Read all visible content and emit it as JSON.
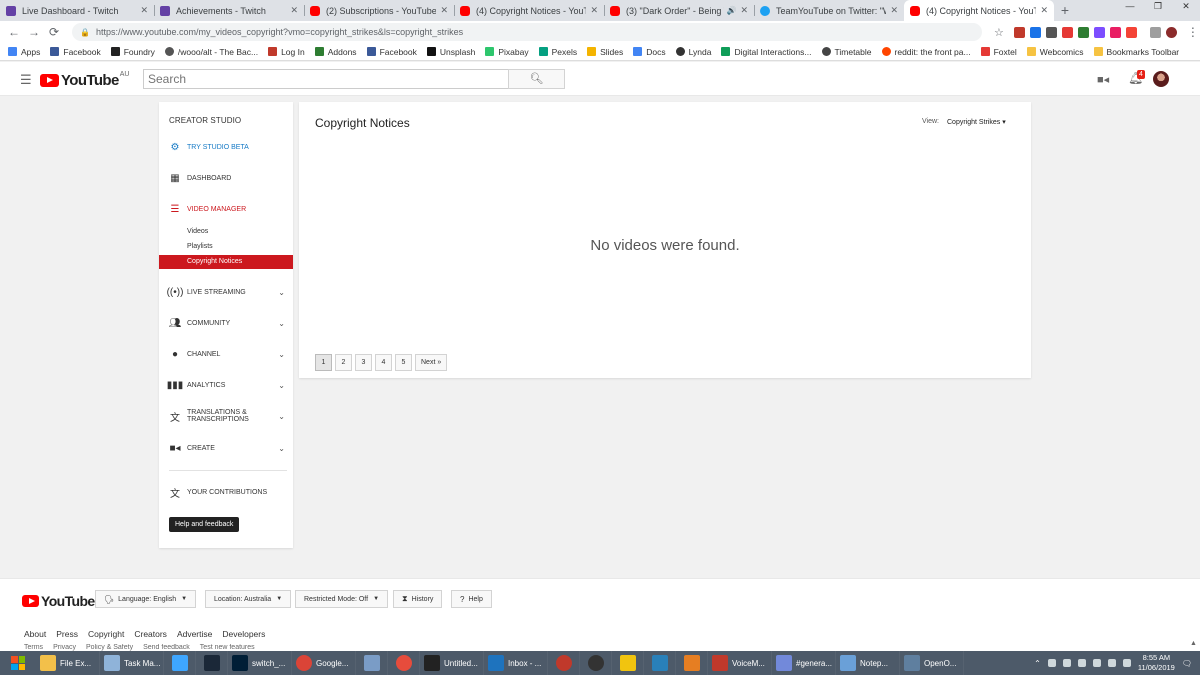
{
  "browser": {
    "tabs": [
      {
        "title": "Live Dashboard - Twitch",
        "icon": "twitch-icon",
        "active": false
      },
      {
        "title": "Achievements - Twitch",
        "icon": "twitch-icon",
        "active": false
      },
      {
        "title": "(2) Subscriptions - YouTube",
        "icon": "youtube-icon",
        "active": false
      },
      {
        "title": "(4) Copyright Notices - YouTube",
        "icon": "youtube-icon",
        "active": false
      },
      {
        "title": "(3) \"Dark Order\" - Being The",
        "icon": "youtube-icon",
        "active": false
      },
      {
        "title": "TeamYouTube on Twitter: \"We'd",
        "icon": "twitter-icon",
        "active": false
      },
      {
        "title": "(4) Copyright Notices - YouTube",
        "icon": "youtube-icon",
        "active": true
      }
    ],
    "new_tab": "+",
    "url": "https://www.youtube.com/my_videos_copyright?vmo=copyright_strikes&ls=copyright_strikes",
    "bookmarks": [
      {
        "label": "Apps",
        "color": "#4285f4"
      },
      {
        "label": "Facebook",
        "color": "#3b5998"
      },
      {
        "label": "Foundry",
        "color": "#222222"
      },
      {
        "label": "/wooo/alt - The Bac...",
        "color": "#555555"
      },
      {
        "label": "Log In",
        "color": "#c0392b"
      },
      {
        "label": "Addons",
        "color": "#2e7d32"
      },
      {
        "label": "Facebook",
        "color": "#3b5998"
      },
      {
        "label": "Unsplash",
        "color": "#111111"
      },
      {
        "label": "Pixabay",
        "color": "#2ec66d"
      },
      {
        "label": "Pexels",
        "color": "#05a081"
      },
      {
        "label": "Slides",
        "color": "#f4b400"
      },
      {
        "label": "Docs",
        "color": "#4285f4"
      },
      {
        "label": "Lynda",
        "color": "#333333"
      },
      {
        "label": "Digital Interactions...",
        "color": "#0f9d58"
      },
      {
        "label": "Timetable",
        "color": "#444444"
      },
      {
        "label": "reddit: the front pa...",
        "color": "#ff4500"
      },
      {
        "label": "Foxtel",
        "color": "#e53935"
      },
      {
        "label": "Webcomics",
        "color": "#f6c342"
      }
    ],
    "bookmarks_toolbar": "Bookmarks Toolbar"
  },
  "masthead": {
    "logo_text": "YouTube",
    "region": "AU",
    "search_placeholder": "Search",
    "notification_count": "4"
  },
  "sidebar": {
    "heading": "CREATOR STUDIO",
    "try_beta": "TRY STUDIO BETA",
    "dashboard": "DASHBOARD",
    "video_manager": "VIDEO MANAGER",
    "sub_items": [
      "Videos",
      "Playlists",
      "Copyright Notices"
    ],
    "live_streaming": "LIVE STREAMING",
    "community": "COMMUNITY",
    "channel": "CHANNEL",
    "analytics": "ANALYTICS",
    "translations_1": "TRANSLATIONS &",
    "translations_2": "TRANSCRIPTIONS",
    "create": "CREATE",
    "contributions": "YOUR CONTRIBUTIONS",
    "help": "Help and feedback"
  },
  "main": {
    "title": "Copyright Notices",
    "view_label": "View:",
    "view_value": "Copyright Strikes",
    "empty_message": "No videos were found.",
    "pages": [
      "1",
      "2",
      "3",
      "4",
      "5"
    ],
    "next": "Next »"
  },
  "footer": {
    "logo_text": "YouTube",
    "language": "Language: English",
    "location": "Location: Australia",
    "restricted": "Restricted Mode: Off",
    "history": "History",
    "help": "Help",
    "links": [
      "About",
      "Press",
      "Copyright",
      "Creators",
      "Advertise",
      "Developers"
    ],
    "links2": [
      "Terms",
      "Privacy",
      "Policy & Safety",
      "Send feedback",
      "Test new features"
    ]
  },
  "taskbar": {
    "items": [
      {
        "label": "File Ex...",
        "color": "#f3c04a"
      },
      {
        "label": "Task Ma...",
        "color": "#8fb3d9"
      },
      {
        "label": "",
        "color": "#3ea6ff"
      },
      {
        "label": "",
        "color": "#1b2838"
      },
      {
        "label": "switch_...",
        "color": "#001e36"
      },
      {
        "label": "Google...",
        "color": "#db4437"
      },
      {
        "label": "",
        "color": "#7a9cc6"
      },
      {
        "label": "",
        "color": "#e74c3c"
      },
      {
        "label": "Untitled...",
        "color": "#222222"
      },
      {
        "label": "Inbox - ...",
        "color": "#1e73be"
      },
      {
        "label": "",
        "color": "#c0392b"
      },
      {
        "label": "",
        "color": "#333333"
      },
      {
        "label": "",
        "color": "#f1c40f"
      },
      {
        "label": "",
        "color": "#2980b9"
      },
      {
        "label": "",
        "color": "#e67e22"
      },
      {
        "label": "VoiceM...",
        "color": "#c0392b"
      },
      {
        "label": "#genera...",
        "color": "#7289da"
      },
      {
        "label": "Notep...",
        "color": "#6aa0d8"
      },
      {
        "label": "OpenO...",
        "color": "#5f7f9f"
      }
    ],
    "time": "8:55 AM",
    "date": "11/06/2019"
  }
}
